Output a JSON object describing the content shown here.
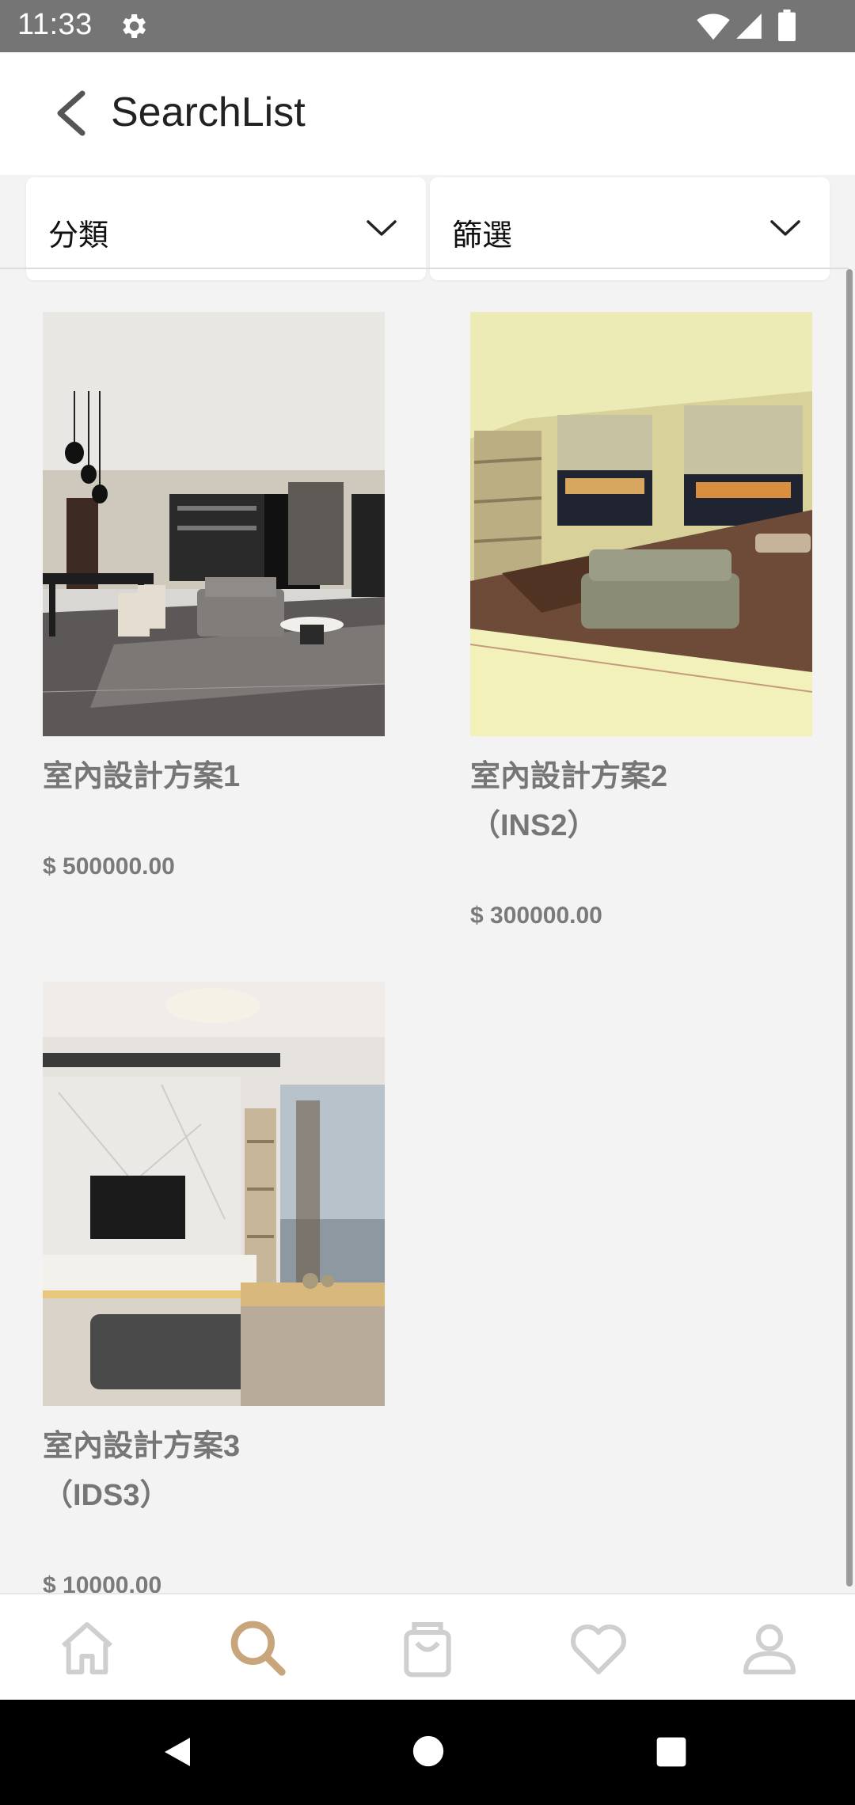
{
  "status_bar": {
    "time": "11:33",
    "icons": [
      "gear-icon",
      "wifi-icon",
      "signal-icon",
      "battery-icon"
    ]
  },
  "app_bar": {
    "title": "SearchList",
    "back_icon": "back-arrow-icon"
  },
  "filters": {
    "category_label": "分類",
    "filter_label": "篩選"
  },
  "products": [
    {
      "name": "室內設計方案1",
      "price": "$ 500000.00"
    },
    {
      "name": "室內設計方案2\n（INS2）",
      "price": "$ 300000.00"
    },
    {
      "name": "室內設計方案3\n（IDS3）",
      "price": "$ 10000.00"
    }
  ],
  "bottom_nav": {
    "items": [
      "home-icon",
      "search-icon",
      "cart-icon",
      "heart-icon",
      "profile-icon"
    ],
    "active": "search-icon"
  },
  "colors": {
    "accent": "#c8a57a",
    "icon_inactive": "#cfcfcf",
    "status_bar": "#757575"
  }
}
